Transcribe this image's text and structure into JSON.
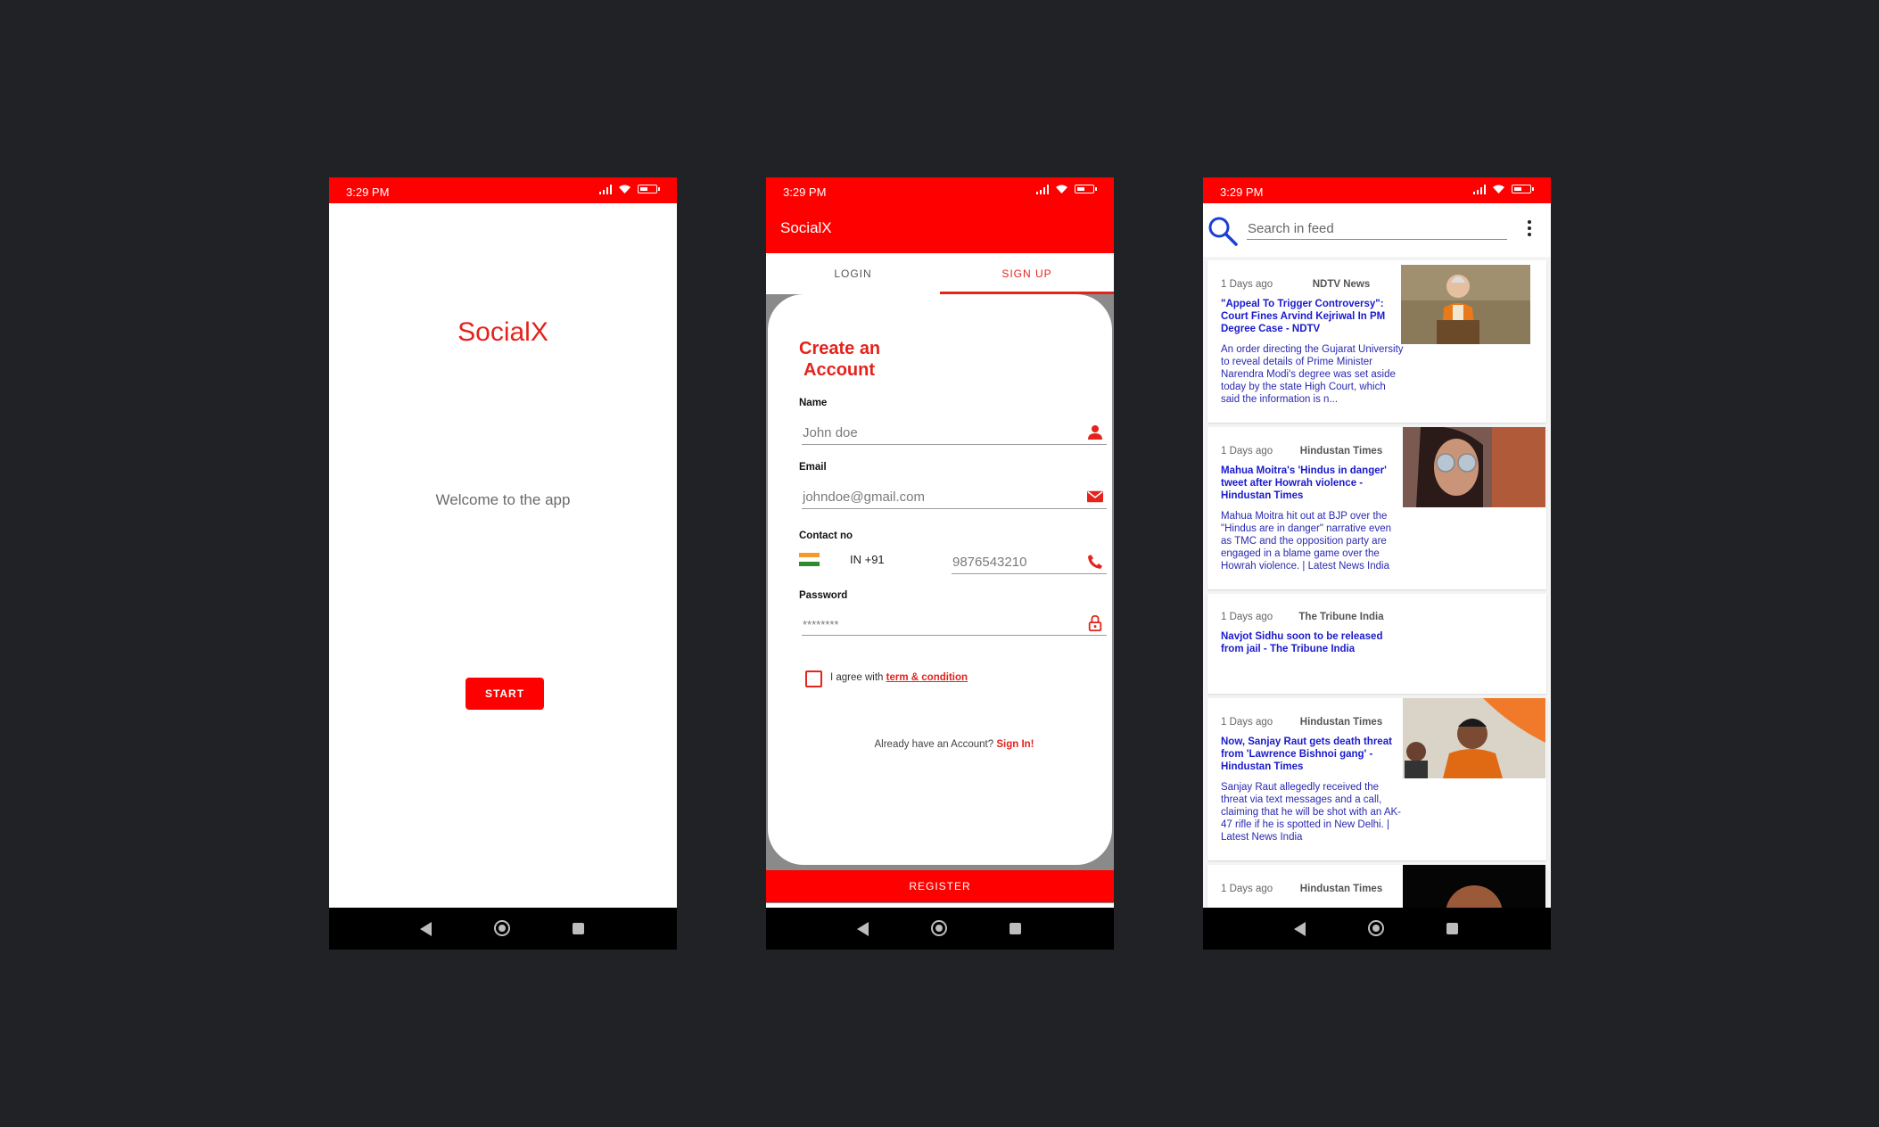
{
  "status_bar": {
    "time": "3:29 PM"
  },
  "screen1": {
    "title": "SocialX",
    "welcome": "Welcome to the app",
    "start_label": "START"
  },
  "screen2": {
    "app_title": "SocialX",
    "tabs": [
      {
        "label": "LOGIN"
      },
      {
        "label": "SIGN UP"
      }
    ],
    "heading_line1": "Create an",
    "heading_line2": "Account",
    "fields": {
      "name": {
        "label": "Name",
        "value": "John doe"
      },
      "email": {
        "label": "Email",
        "value": "johndoe@gmail.com"
      },
      "contact": {
        "label": "Contact no",
        "country_code": "IN +91",
        "value": "9876543210"
      },
      "password": {
        "label": "Password",
        "value": "********"
      }
    },
    "agree_prefix": "I agree with",
    "agree_link": "term & condition",
    "already_text": "Already have an Account?",
    "signin_link": "Sign In!",
    "register_label": "REGISTER"
  },
  "screen3": {
    "search_placeholder": "Search in feed",
    "articles": [
      {
        "time": "1 Days ago",
        "source": "NDTV News",
        "headline": "\"Appeal To Trigger Controversy\": Court Fines Arvind Kejriwal In PM Degree Case - NDTV",
        "description": "An order directing the Gujarat University to reveal details of Prime Minister Narendra Modi's degree was set aside today by the state High Court, which said the information is n..."
      },
      {
        "time": "1 Days ago",
        "source": "Hindustan Times",
        "headline": "Mahua Moitra's 'Hindus in danger' tweet after Howrah violence - Hindustan Times",
        "description": "Mahua Moitra hit out at BJP over the \"Hindus are in danger\" narrative even as TMC and the opposition party are engaged in a blame game over the Howrah violence. | Latest News India"
      },
      {
        "time": "1 Days ago",
        "source": "The Tribune India",
        "headline": "Navjot Sidhu soon to be released from jail - The Tribune India",
        "description": ""
      },
      {
        "time": "1 Days ago",
        "source": "Hindustan Times",
        "headline": "Now, Sanjay Raut gets death threat from 'Lawrence Bishnoi gang' - Hindustan Times",
        "description": "Sanjay Raut allegedly received the threat via text messages and a call, claiming that he will be shot with an AK-47 rifle if he is spotted in New Delhi. | Latest News India"
      },
      {
        "time": "1 Days ago",
        "source": "Hindustan Times",
        "headline": "",
        "description": ""
      }
    ]
  },
  "colors": {
    "accent": "#ff0000",
    "accent_text": "#e4231c",
    "link_blue": "#1a1acc",
    "background": "#202226"
  }
}
